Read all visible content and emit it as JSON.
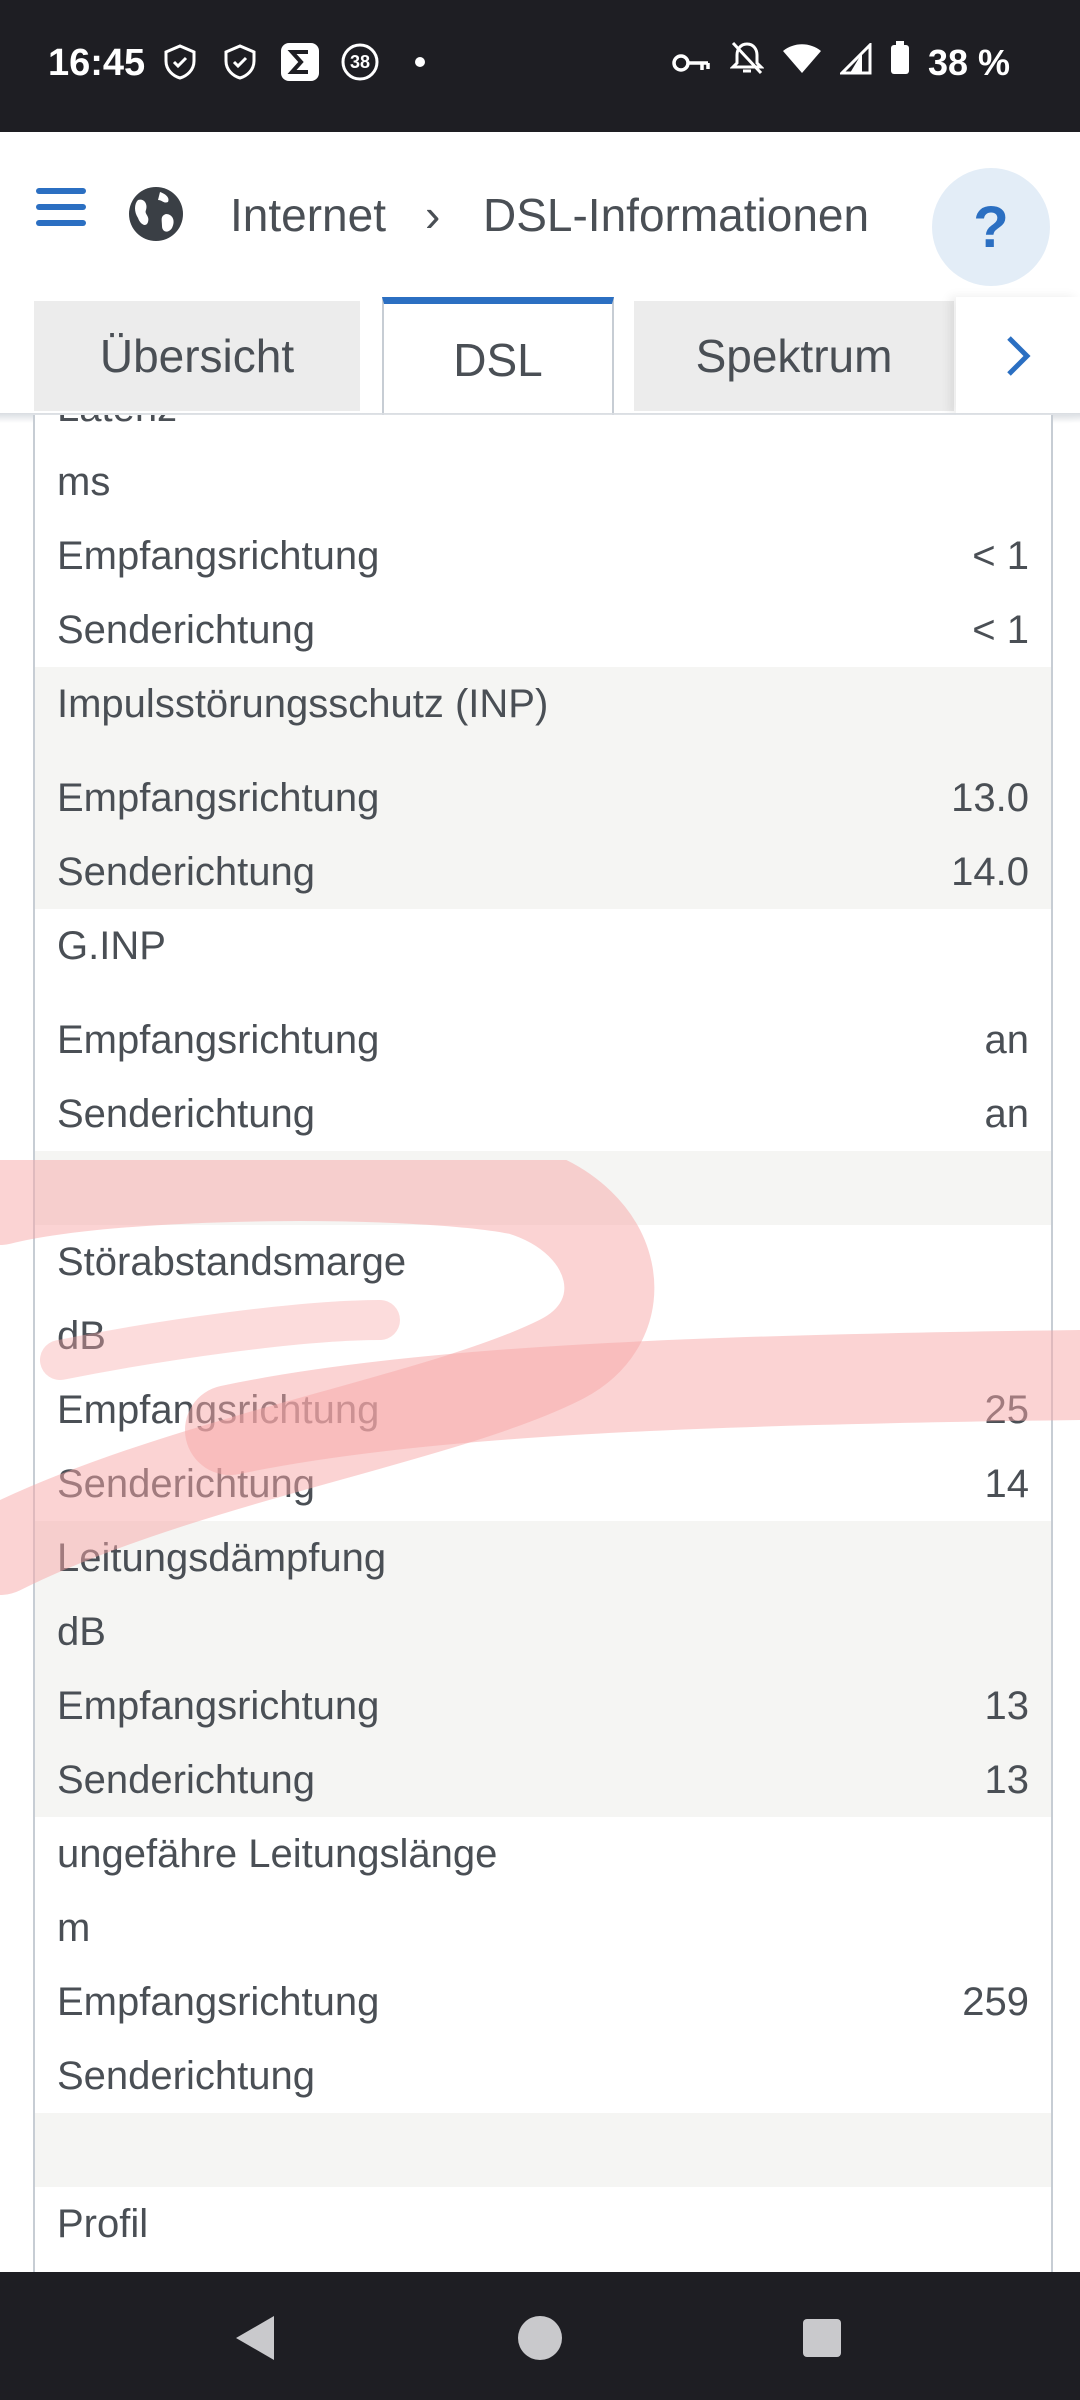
{
  "status_bar": {
    "time": "16:45",
    "notification_count": "38",
    "battery": "38 %",
    "icons": [
      "shield-icon",
      "shield-icon",
      "sigma-icon",
      "badge-icon",
      "dot-icon",
      "key-icon",
      "bell-off-icon",
      "wifi-icon",
      "signal-icon",
      "battery-icon"
    ]
  },
  "appbar": {
    "breadcrumb_1": "Internet",
    "breadcrumb_sep": "›",
    "breadcrumb_2": "DSL-Informationen",
    "help_label": "?"
  },
  "tabs": [
    {
      "label": "Übersicht",
      "active": false
    },
    {
      "label": "DSL",
      "active": true
    },
    {
      "label": "Spektrum",
      "active": false
    }
  ],
  "rows": [
    {
      "label": "Latenz",
      "value": "",
      "grey": false
    },
    {
      "label": "ms",
      "value": "",
      "grey": false
    },
    {
      "label": "Empfangsrichtung",
      "value": "< 1",
      "grey": false
    },
    {
      "label": "Senderichtung",
      "value": "< 1",
      "grey": false
    },
    {
      "label": "Impulsstörungsschutz (INP)",
      "value": "",
      "grey": true
    },
    {
      "label": "",
      "value": "",
      "grey": true
    },
    {
      "label": "Empfangsrichtung",
      "value": "13.0",
      "grey": true
    },
    {
      "label": "Senderichtung",
      "value": "14.0",
      "grey": true
    },
    {
      "label": "G.INP",
      "value": "",
      "grey": false
    },
    {
      "label": "",
      "value": "",
      "grey": false
    },
    {
      "label": "Empfangsrichtung",
      "value": "an",
      "grey": false
    },
    {
      "label": "Senderichtung",
      "value": "an",
      "grey": false
    },
    {
      "label": "",
      "value": "",
      "grey": true
    },
    {
      "label": "Störabstandsmarge",
      "value": "",
      "grey": false
    },
    {
      "label": "dB",
      "value": "",
      "grey": false
    },
    {
      "label": "Empfangsrichtung",
      "value": "25",
      "grey": false
    },
    {
      "label": "Senderichtung",
      "value": "14",
      "grey": false
    },
    {
      "label": "Leitungsdämpfung",
      "value": "",
      "grey": true
    },
    {
      "label": "dB",
      "value": "",
      "grey": true
    },
    {
      "label": "Empfangsrichtung",
      "value": "13",
      "grey": true
    },
    {
      "label": "Senderichtung",
      "value": "13",
      "grey": true
    },
    {
      "label": "ungefähre Leitungslänge",
      "value": "",
      "grey": false
    },
    {
      "label": "m",
      "value": "",
      "grey": false
    },
    {
      "label": "Empfangsrichtung",
      "value": "259",
      "grey": false
    },
    {
      "label": "Senderichtung",
      "value": "",
      "grey": false
    },
    {
      "label": "",
      "value": "",
      "grey": true
    },
    {
      "label": "Profil",
      "value": "",
      "grey": false
    }
  ],
  "colors": {
    "accent": "#2b6fc2",
    "grey_row": "#f5f5f3",
    "scribble": "#f7a8a8"
  }
}
